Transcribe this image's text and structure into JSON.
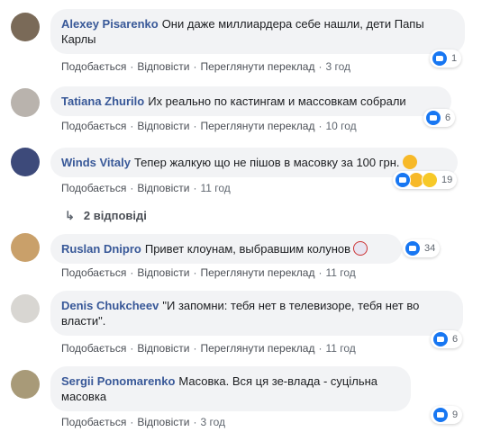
{
  "comments": [
    {
      "author": "Alexey Pisarenko",
      "text": "Они даже миллиардера себе нашли, дети Папы Карлы",
      "like": "Подобається",
      "reply": "Відповісти",
      "translate": "Переглянути переклад",
      "time": "3 год",
      "reactions": "1",
      "avatar_color": "#7a6a58"
    },
    {
      "author": "Tatiana Zhurilo",
      "text": "Их реально по кастингам и массовкам собрали",
      "like": "Подобається",
      "reply": "Відповісти",
      "translate": "Переглянути переклад",
      "time": "10 год",
      "reactions": "6",
      "avatar_color": "#b9b3ad"
    },
    {
      "author": "Winds Vitaly",
      "text": "Тепер жалкую що не пішов в масовку за 100 грн.",
      "like": "Подобається",
      "reply": "Відповісти",
      "time": "11 год",
      "reactions": "19",
      "avatar_color": "#3d4a7a"
    },
    {
      "author": "Ruslan Dnipro",
      "text": "Привет клоунам, выбравшим колунов",
      "like": "Подобається",
      "reply": "Відповісти",
      "translate": "Переглянути переклад",
      "time": "11 год",
      "reactions": "34",
      "avatar_color": "#c9a06a"
    },
    {
      "author": "Denis Chukcheev",
      "text": "\"И запомни: тебя нет в телевизоре, тебя нет во власти\".",
      "like": "Подобається",
      "reply": "Відповісти",
      "translate": "Переглянути переклад",
      "time": "11 год",
      "reactions": "6",
      "avatar_color": "#d8d6d2"
    },
    {
      "author": "Sergii Ponomarenko",
      "text": "Масовка. Вся ця зе-влада - суцільна масовка",
      "like": "Подобається",
      "reply": "Відповісти",
      "time": "3 год",
      "reactions": "9",
      "avatar_color": "#a89a78"
    }
  ],
  "replies_link": "2 відповіді"
}
